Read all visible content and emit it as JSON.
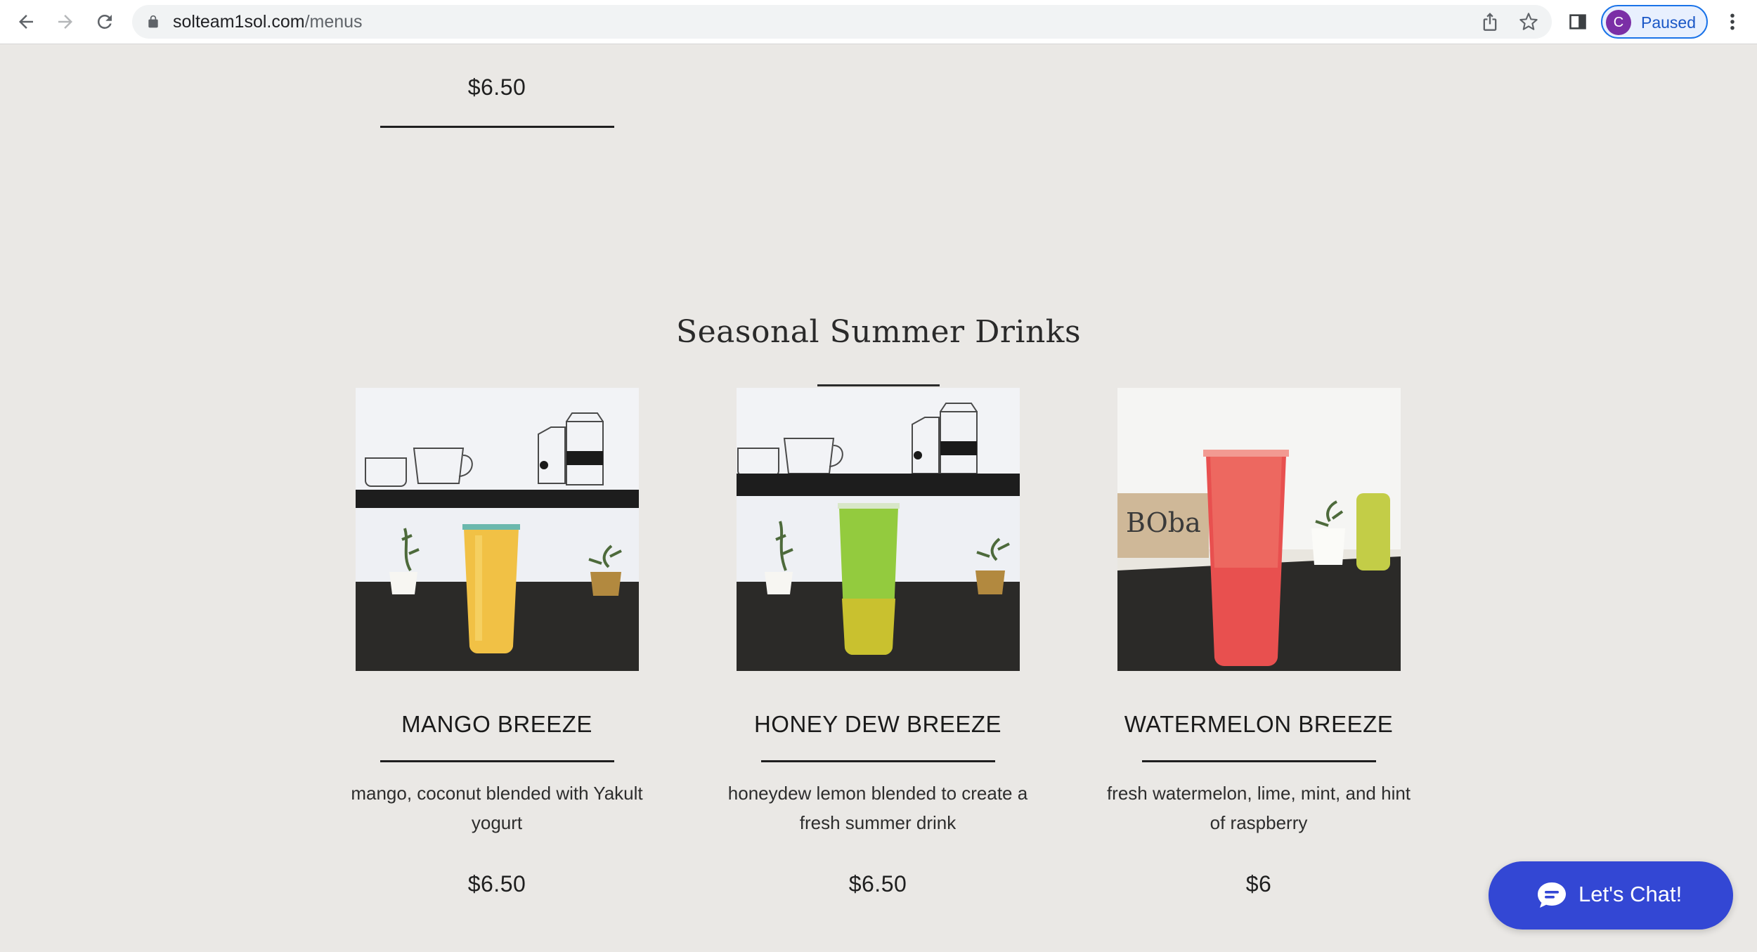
{
  "browser": {
    "url_host": "solteam1sol.com",
    "url_path": "/menus",
    "profile_initial": "C",
    "profile_status": "Paused"
  },
  "page": {
    "top_item_price": "$6.50",
    "section_title": "Seasonal Summer Drinks",
    "products": [
      {
        "name": "MANGO BREEZE",
        "description": "mango, coconut blended with Yakult yogurt",
        "price": "$6.50",
        "image_alt": "mango breeze drink photo"
      },
      {
        "name": "HONEY DEW BREEZE",
        "description": "honeydew lemon blended to create a fresh summer drink",
        "price": "$6.50",
        "image_alt": "honey dew breeze drink photo"
      },
      {
        "name": "WATERMELON BREEZE",
        "description": "fresh watermelon, lime, mint, and hint of raspberry",
        "price": "$6",
        "image_alt": "watermelon breeze drink photo"
      }
    ]
  },
  "chat_widget": {
    "label": "Let's Chat!",
    "color": "#3347d4"
  },
  "icons": {
    "back": "back-arrow-icon",
    "forward": "forward-arrow-icon",
    "reload": "reload-icon",
    "lock": "lock-icon",
    "share": "share-icon",
    "bookmark": "star-icon",
    "side_panel": "side-panel-icon",
    "menu": "kebab-menu-icon",
    "chat": "chat-bubble-icon"
  }
}
